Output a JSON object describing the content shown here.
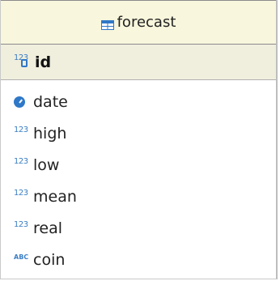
{
  "entity": {
    "title": "forecast",
    "primary_key": {
      "name": "id",
      "icon": "numeric-key-icon"
    },
    "columns": [
      {
        "name": "date",
        "icon": "clock-icon"
      },
      {
        "name": "high",
        "icon": "numeric-icon",
        "icon_text": "123"
      },
      {
        "name": "low",
        "icon": "numeric-icon",
        "icon_text": "123"
      },
      {
        "name": "mean",
        "icon": "numeric-icon",
        "icon_text": "123"
      },
      {
        "name": "real",
        "icon": "numeric-icon",
        "icon_text": "123"
      },
      {
        "name": "coin",
        "icon": "text-icon",
        "icon_text": "ABC"
      }
    ],
    "pk_icon_text": "123"
  }
}
